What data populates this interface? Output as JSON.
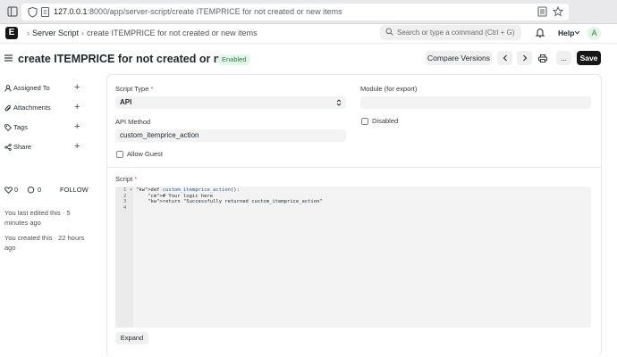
{
  "browser": {
    "url_host": "127.0.0.1",
    "url_rest": ":8000/app/server-script/create ITEMPRICE for not created or new items"
  },
  "navbar": {
    "breadcrumbs": [
      "Server Script",
      "create ITEMPRICE for not created or new items"
    ],
    "search_placeholder": "Search or type a command (Ctrl + G)",
    "help_label": "Help",
    "avatar_initial": "A"
  },
  "page": {
    "title": "create ITEMPRICE for not created or new...",
    "status": "Enabled",
    "compare_label": "Compare Versions",
    "more_label": "...",
    "save_label": "Save"
  },
  "sidebar": {
    "items": [
      {
        "label": "Assigned To",
        "icon": "user-icon"
      },
      {
        "label": "Attachments",
        "icon": "paperclip-icon"
      },
      {
        "label": "Tags",
        "icon": "tag-icon"
      },
      {
        "label": "Share",
        "icon": "share-icon"
      }
    ],
    "like_count": "0",
    "comment_count": "0",
    "follow_label": "FOLLOW",
    "last_edited": "You last edited this · 5 minutes ago",
    "created": "You created this · 22 hours ago"
  },
  "form": {
    "script_type_label": "Script Type",
    "script_type_value": "API",
    "module_label": "Module (for export)",
    "module_value": "",
    "disabled_label": "Disabled",
    "api_method_label": "API Method",
    "api_method_value": "custom_itemprice_action",
    "allow_guest_label": "Allow Guest",
    "script_label": "Script",
    "expand_label": "Expand",
    "code_lines": [
      {
        "num": "1",
        "text": "def custom_itemprice_action():"
      },
      {
        "num": "2",
        "text": "    # Your logic here"
      },
      {
        "num": "3",
        "text": "    return \"Successfully returned custom_itemprice_action\""
      },
      {
        "num": "4",
        "text": ""
      }
    ]
  },
  "colors": {
    "primary_button": "#171717",
    "badge_bg": "#e4f5e9",
    "badge_text": "#2f7d4a"
  }
}
